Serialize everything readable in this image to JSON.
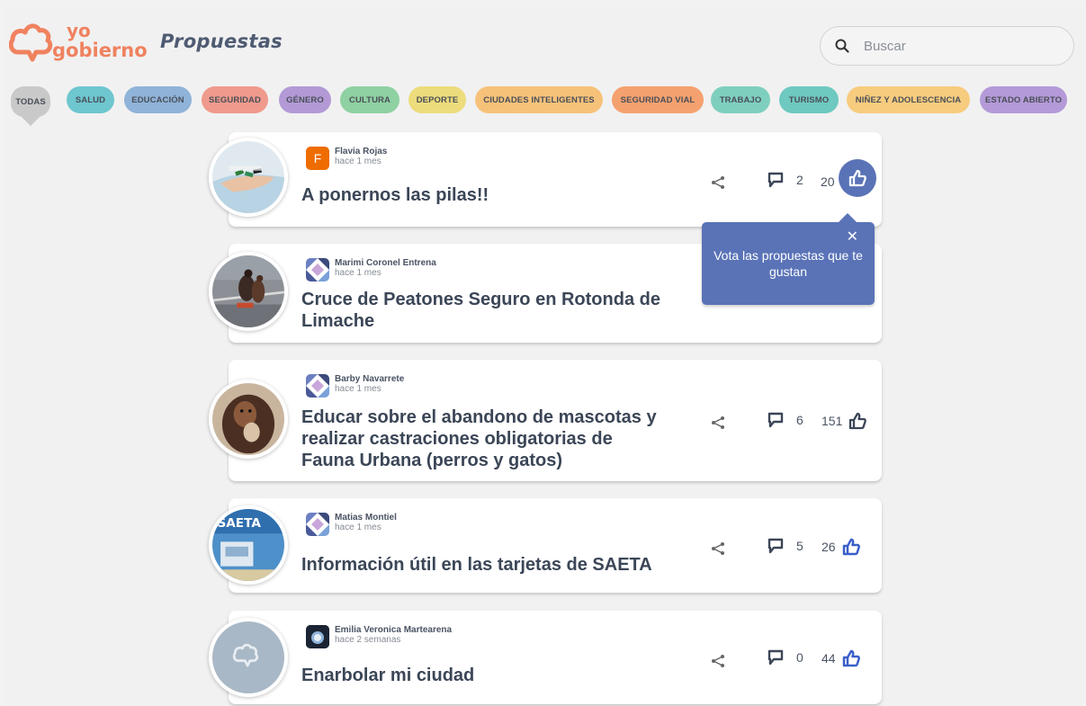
{
  "header": {
    "title": "Propuestas",
    "logo_top": "yo",
    "logo_bottom": "gobierno",
    "search_placeholder": "Buscar"
  },
  "categories": [
    {
      "label": "TODAS",
      "color": "#c9c9c9"
    },
    {
      "label": "SALUD",
      "color": "#6ec6cf"
    },
    {
      "label": "EDUCACIÓN",
      "color": "#8fb3d9"
    },
    {
      "label": "SEGURIDAD",
      "color": "#ef9a8c"
    },
    {
      "label": "GÉNERO",
      "color": "#b39ad6"
    },
    {
      "label": "CULTURA",
      "color": "#8fd1a2"
    },
    {
      "label": "DEPORTE",
      "color": "#ecdc7c"
    },
    {
      "label": "CIUDADES INTELIGENTES",
      "color": "#f6c27a"
    },
    {
      "label": "SEGURIDAD VIAL",
      "color": "#f5a16f"
    },
    {
      "label": "TRABAJO",
      "color": "#7fcfbe"
    },
    {
      "label": "TURISMO",
      "color": "#6ec9c0"
    },
    {
      "label": "NIÑEZ Y ADOLESCENCIA",
      "color": "#f7cc7e"
    },
    {
      "label": "ESTADO ABIERTO",
      "color": "#b49ad8"
    }
  ],
  "proposals": [
    {
      "author": "Flavia Rojas",
      "time": "hace 1 mes",
      "title": "A ponernos las pilas!!",
      "comments": "2",
      "votes": "20"
    },
    {
      "author": "Marimi Coronel Entrena",
      "time": "hace 1 mes",
      "title": "Cruce de Peatones Seguro en Rotonda de Limache",
      "comments": "",
      "votes": ""
    },
    {
      "author": "Barby Navarrete",
      "time": "hace 1 mes",
      "title": "Educar sobre el abandono de mascotas y realizar castraciones obligatorias de Fauna Urbana (perros y gatos)",
      "comments": "6",
      "votes": "151"
    },
    {
      "author": "Matias Montiel",
      "time": "hace 1 mes",
      "title": "Información útil en las tarjetas de SAETA",
      "comments": "5",
      "votes": "26"
    },
    {
      "author": "Emilia Veronica Martearena",
      "time": "hace 2 semanas",
      "title": "Enarbolar mi ciudad",
      "comments": "0",
      "votes": "44"
    }
  ],
  "avatar_initial": "F",
  "thumb_text_saeta": "SAETA",
  "tooltip": {
    "text": "Vota las propuestas que te gustan",
    "close": "✕"
  },
  "colors": {
    "brand_orange": "#f0825f",
    "brand_blue": "#4e5b72",
    "accent_blue": "#5a73b7"
  }
}
